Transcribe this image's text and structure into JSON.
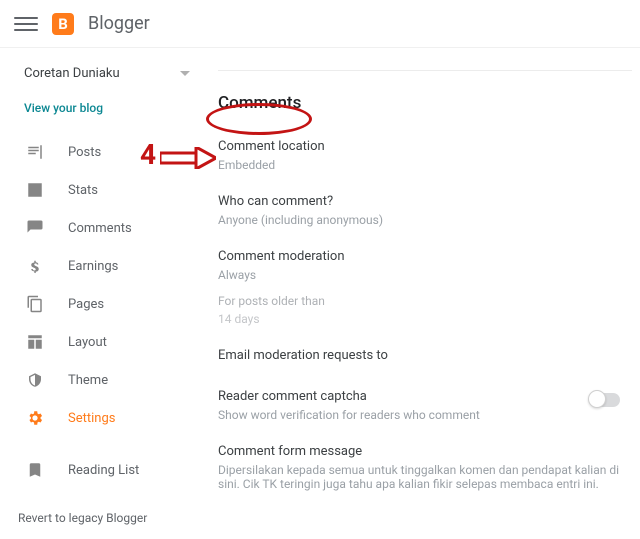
{
  "brand": "Blogger",
  "blogName": "Coretan Duniaku",
  "viewBlog": "View your blog",
  "nav": {
    "posts": "Posts",
    "stats": "Stats",
    "comments": "Comments",
    "earnings": "Earnings",
    "pages": "Pages",
    "layout": "Layout",
    "theme": "Theme",
    "settings": "Settings",
    "readingList": "Reading List"
  },
  "revert": "Revert to legacy Blogger",
  "section": {
    "title": "Comments",
    "commentLocation": {
      "label": "Comment location",
      "value": "Embedded"
    },
    "whoCanComment": {
      "label": "Who can comment?",
      "value": "Anyone (including anonymous)"
    },
    "moderation": {
      "label": "Comment moderation",
      "value": "Always",
      "subLabel": "For posts older than",
      "subValue": "14 days"
    },
    "emailModeration": {
      "label": "Email moderation requests to"
    },
    "captcha": {
      "label": "Reader comment captcha",
      "value": "Show word verification for readers who comment",
      "enabled": false
    },
    "formMessage": {
      "label": "Comment form message",
      "value": "Dipersilakan kepada semua untuk tinggalkan komen dan pendapat kalian di sini. Cik TK teringin juga tahu apa kalian fikir selepas membaca entri ini."
    }
  },
  "annotation": {
    "number": "4"
  }
}
